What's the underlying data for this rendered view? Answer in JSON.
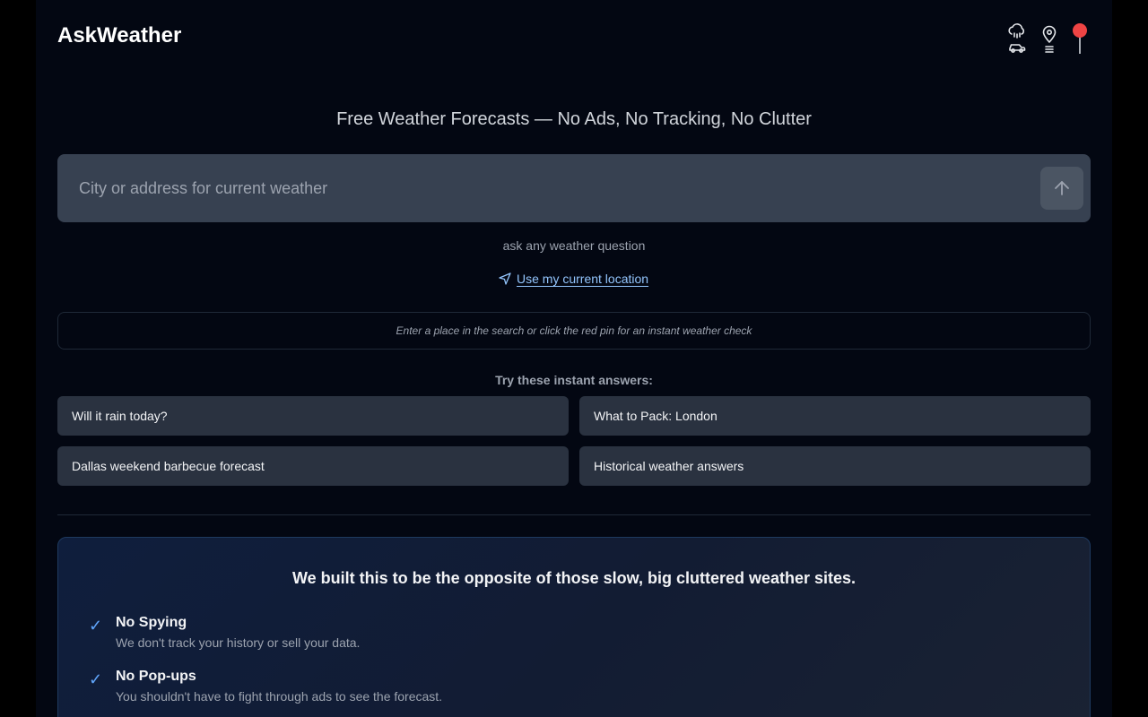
{
  "header": {
    "brand": "AskWeather",
    "icons": [
      "cloud-rain-car-icon",
      "map-pin-list-icon",
      "red-pin-icon"
    ]
  },
  "hero": {
    "title": "Free Weather Forecasts — No Ads, No Tracking, No Clutter"
  },
  "search": {
    "placeholder": "City or address for current weather",
    "value": "",
    "submit_icon": "arrow-up-icon"
  },
  "hint": "ask any weather question",
  "location_link": "Use my current location",
  "notice": "Enter a place in the search or click the red pin for an instant weather check",
  "suggestions": {
    "label": "Try these instant answers:",
    "items": [
      "Will it rain today?",
      "What to Pack: London",
      "Dallas weekend barbecue forecast",
      "Historical weather answers"
    ]
  },
  "promo": {
    "title": "We built this to be the opposite of those slow, big cluttered weather sites.",
    "features": [
      {
        "title": "No Spying",
        "desc": "We don't track your history or sell your data."
      },
      {
        "title": "No Pop-ups",
        "desc": "You shouldn't have to fight through ads to see the forecast."
      }
    ]
  },
  "colors": {
    "background": "#030712",
    "accent": "#60a5fa",
    "pin": "#ef4444",
    "card": "#2a3240",
    "input": "#374151"
  }
}
